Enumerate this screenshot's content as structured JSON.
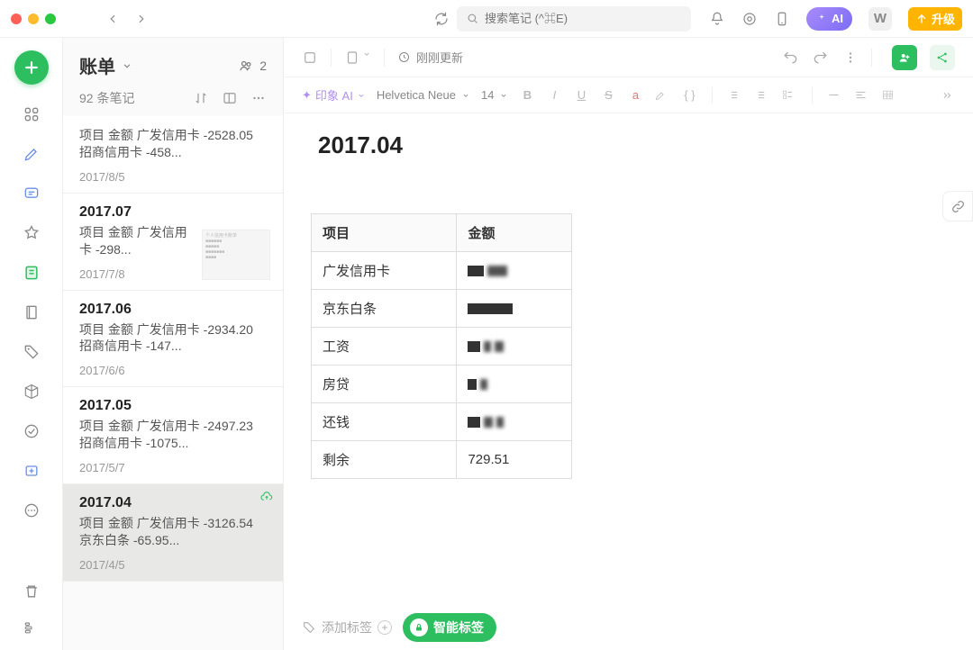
{
  "titlebar": {
    "search_placeholder": "搜索笔记 (^⌘E)",
    "ai_label": "AI",
    "w_label": "W",
    "upgrade_label": "升级"
  },
  "notelist": {
    "title": "账单",
    "people_count": "2",
    "count_label": "92 条笔记"
  },
  "items": [
    {
      "title": "",
      "body": "项目 金额 广发信用卡 -2528.05 招商信用卡 -458...",
      "date": "2017/8/5",
      "selected": false,
      "thumb": false
    },
    {
      "title": "2017.07",
      "body": "项目 金额 广发信用卡 -298...",
      "date": "2017/7/8",
      "selected": false,
      "thumb": true
    },
    {
      "title": "2017.06",
      "body": "项目 金额 广发信用卡 -2934.20 招商信用卡 -147...",
      "date": "2017/6/6",
      "selected": false,
      "thumb": false
    },
    {
      "title": "2017.05",
      "body": "项目 金额 广发信用卡 -2497.23 招商信用卡 -1075...",
      "date": "2017/5/7",
      "selected": false,
      "thumb": false
    },
    {
      "title": "2017.04",
      "body": "项目 金额 广发信用卡 -3126.54 京东白条 -65.95...",
      "date": "2017/4/5",
      "selected": true,
      "thumb": false
    }
  ],
  "editor": {
    "updated_label": "刚刚更新",
    "ai_label": "印象 AI",
    "font_name": "Helvetica Neue",
    "font_size": "14",
    "doc_title": "2017.04",
    "table_header_1": "项目",
    "table_header_2": "金额",
    "rows": [
      {
        "k": "广发信用卡",
        "v": ""
      },
      {
        "k": "京东白条",
        "v": ""
      },
      {
        "k": "工资",
        "v": ""
      },
      {
        "k": "房贷",
        "v": ""
      },
      {
        "k": "还钱",
        "v": ""
      },
      {
        "k": "剩余",
        "v": "729.51"
      }
    ],
    "add_tag_label": "添加标签",
    "smart_tag_label": "智能标签"
  }
}
